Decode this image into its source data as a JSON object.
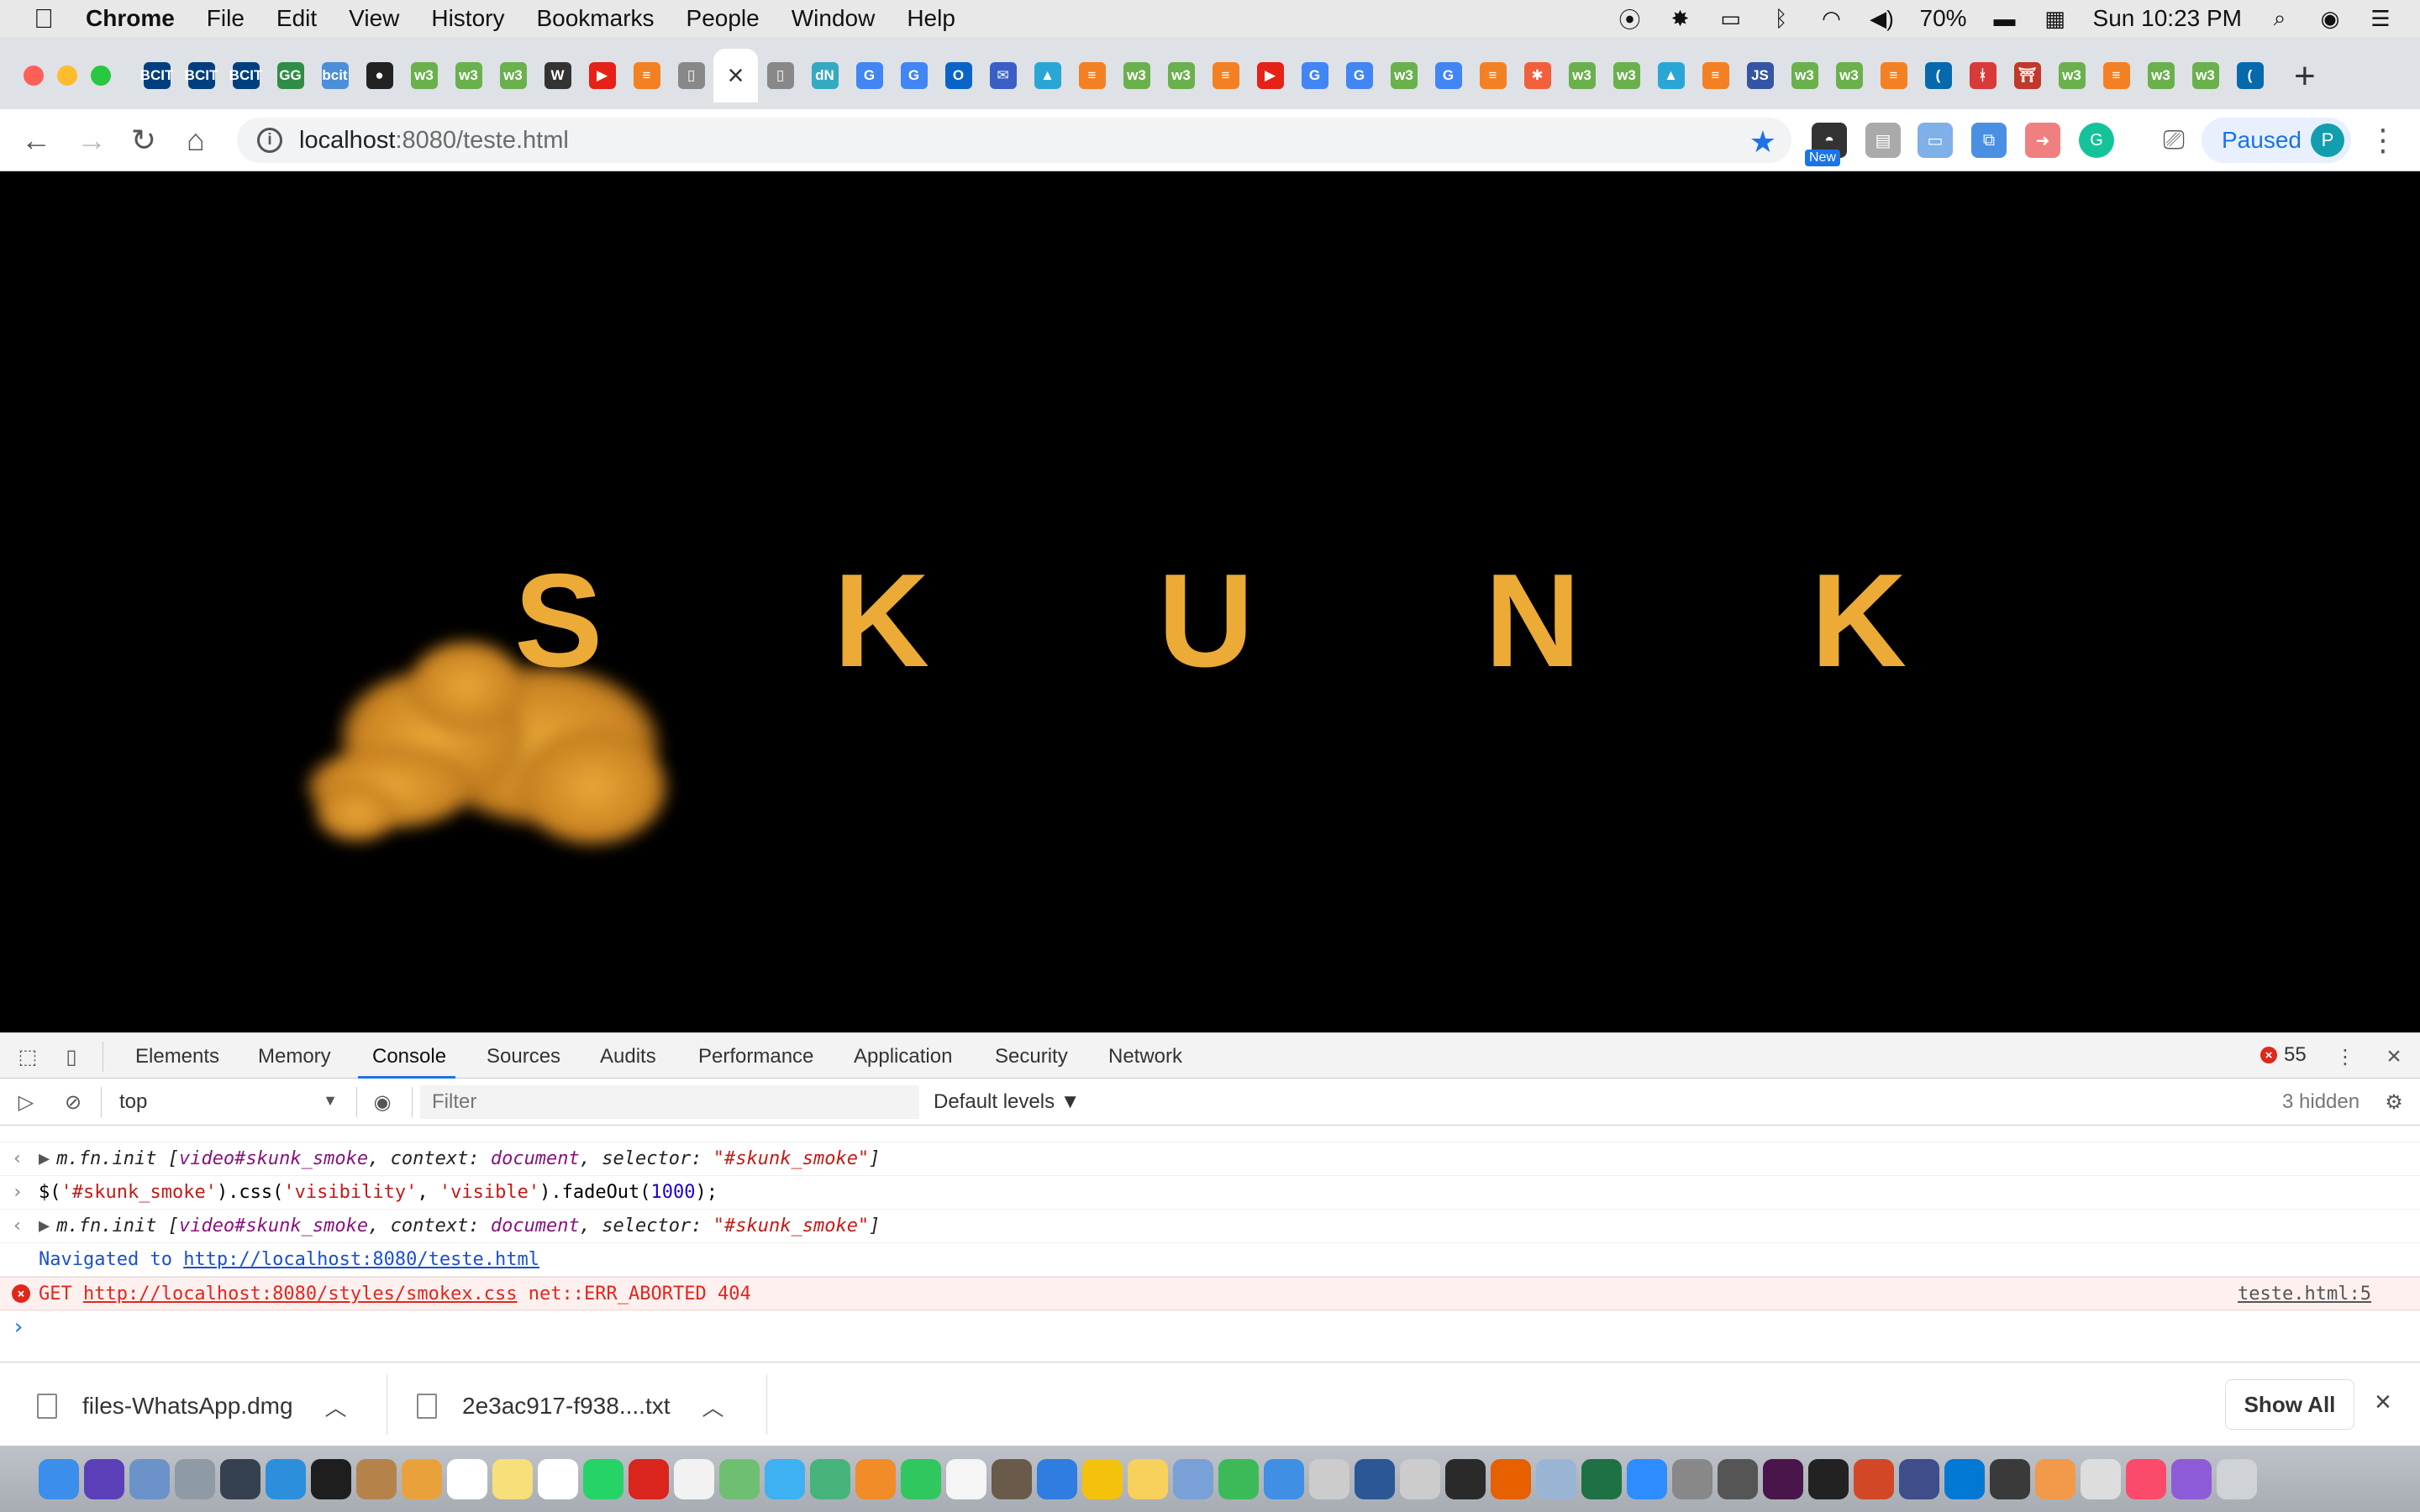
{
  "menubar": {
    "app_name": "Chrome",
    "items": [
      "File",
      "Edit",
      "View",
      "History",
      "Bookmarks",
      "People",
      "Window",
      "Help"
    ],
    "battery": "70%",
    "clock": "Sun 10:23 PM"
  },
  "tabs": [
    {
      "icon": "bcit-icon",
      "glyph": "BCIT",
      "color": "#003f7d"
    },
    {
      "icon": "bcit-icon",
      "glyph": "BCIT",
      "color": "#003f7d"
    },
    {
      "icon": "bcit-icon",
      "glyph": "BCIT",
      "color": "#003f7d"
    },
    {
      "icon": "geeksforgeeks-icon",
      "glyph": "GG",
      "color": "#2f8d46"
    },
    {
      "icon": "bcit-icon",
      "glyph": "bcit",
      "color": "#4a8fd8"
    },
    {
      "icon": "github-icon",
      "glyph": "●",
      "color": "#222222"
    },
    {
      "icon": "w3schools-icon",
      "glyph": "w3",
      "color": "#6ab04c"
    },
    {
      "icon": "w3schools-icon",
      "glyph": "w3",
      "color": "#6ab04c"
    },
    {
      "icon": "w3schools-icon",
      "glyph": "w3",
      "color": "#6ab04c"
    },
    {
      "icon": "wikipedia-icon",
      "glyph": "W",
      "color": "#333333"
    },
    {
      "icon": "youtube-icon",
      "glyph": "▶",
      "color": "#e62117"
    },
    {
      "icon": "stackoverflow-icon",
      "glyph": "≡",
      "color": "#f48024"
    },
    {
      "icon": "document-icon",
      "glyph": "▯",
      "color": "#888888"
    },
    {
      "icon": "close-icon",
      "glyph": "×",
      "color": "#ffffff",
      "active": true
    },
    {
      "icon": "document-icon",
      "glyph": "▯",
      "color": "#888888"
    },
    {
      "icon": "dn-icon",
      "glyph": "dN",
      "color": "#36a9c2"
    },
    {
      "icon": "google-icon",
      "glyph": "G",
      "color": "#4285f4"
    },
    {
      "icon": "google-icon",
      "glyph": "G",
      "color": "#4285f4"
    },
    {
      "icon": "outlook-icon",
      "glyph": "O",
      "color": "#0a64c8"
    },
    {
      "icon": "mail-icon",
      "glyph": "✉",
      "color": "#3a5ec4"
    },
    {
      "icon": "graduation-cap-icon",
      "glyph": "▲",
      "color": "#2aa6d6"
    },
    {
      "icon": "stackoverflow-icon",
      "glyph": "≡",
      "color": "#f48024"
    },
    {
      "icon": "w3schools-icon",
      "glyph": "w3",
      "color": "#6ab04c"
    },
    {
      "icon": "w3schools-icon",
      "glyph": "w3",
      "color": "#6ab04c"
    },
    {
      "icon": "stackoverflow-icon",
      "glyph": "≡",
      "color": "#f48024"
    },
    {
      "icon": "video-icon",
      "glyph": "▶",
      "color": "#e62117"
    },
    {
      "icon": "google-icon",
      "glyph": "G",
      "color": "#4285f4"
    },
    {
      "icon": "google-icon",
      "glyph": "G",
      "color": "#4285f4"
    },
    {
      "icon": "w3schools-icon",
      "glyph": "w3",
      "color": "#6ab04c"
    },
    {
      "icon": "google-icon",
      "glyph": "G",
      "color": "#4285f4"
    },
    {
      "icon": "stackoverflow-icon",
      "glyph": "≡",
      "color": "#f48024"
    },
    {
      "icon": "asterisk-icon",
      "glyph": "✱",
      "color": "#f25f3a"
    },
    {
      "icon": "w3schools-icon",
      "glyph": "w3",
      "color": "#6ab04c"
    },
    {
      "icon": "w3schools-icon",
      "glyph": "w3",
      "color": "#6ab04c"
    },
    {
      "icon": "graduation-cap-icon",
      "glyph": "▲",
      "color": "#2aa6d6"
    },
    {
      "icon": "stackoverflow-icon",
      "glyph": "≡",
      "color": "#f48024"
    },
    {
      "icon": "tutorial-icon",
      "glyph": "JS",
      "color": "#3455a4"
    },
    {
      "icon": "w3schools-icon",
      "glyph": "w3",
      "color": "#6ab04c"
    },
    {
      "icon": "w3schools-icon",
      "glyph": "w3",
      "color": "#6ab04c"
    },
    {
      "icon": "stackoverflow-icon",
      "glyph": "≡",
      "color": "#f48024"
    },
    {
      "icon": "jquery-icon",
      "glyph": "(",
      "color": "#0769ad"
    },
    {
      "icon": "figure-icon",
      "glyph": "ᚼ",
      "color": "#d83a3a"
    },
    {
      "icon": "gate-icon",
      "glyph": "⛩",
      "color": "#c0392b"
    },
    {
      "icon": "w3schools-icon",
      "glyph": "w3",
      "color": "#6ab04c"
    },
    {
      "icon": "stackoverflow-icon",
      "glyph": "≡",
      "color": "#f48024"
    },
    {
      "icon": "w3schools-icon",
      "glyph": "w3",
      "color": "#6ab04c"
    },
    {
      "icon": "w3schools-icon",
      "glyph": "w3",
      "color": "#6ab04c"
    },
    {
      "icon": "jquery-icon",
      "glyph": "(",
      "color": "#0769ad"
    }
  ],
  "omnibox": {
    "host": "localhost",
    "rest": ":8080/teste.html"
  },
  "extensions": {
    "new_badge": "New"
  },
  "profile": {
    "status": "Paused",
    "initial": "P"
  },
  "page": {
    "letters": [
      "S",
      "K",
      "U",
      "N",
      "K"
    ],
    "letter_color": "#ecaa36",
    "background": "#000000"
  },
  "devtools": {
    "tabs": [
      "Elements",
      "Memory",
      "Console",
      "Sources",
      "Audits",
      "Performance",
      "Application",
      "Security",
      "Network"
    ],
    "active_tab": "Console",
    "error_count": "55",
    "context": "top",
    "filter_placeholder": "Filter",
    "levels": "Default levels ▼",
    "hidden": "3 hidden",
    "console": {
      "line1": {
        "obj": "m.fn.init [",
        "tag": "video#skunk_smoke",
        "mid": ", context: ",
        "ctx": "document",
        "mid2": ", selector: ",
        "sel": "\"#skunk_smoke\"",
        "end": "]"
      },
      "cmd": {
        "a": "$(",
        "s1": "'#skunk_smoke'",
        "b": ").css(",
        "s2": "'visibility'",
        "c": ", ",
        "s3": "'visible'",
        "d": ").fadeOut(",
        "n": "1000",
        "e": ");"
      },
      "nav_label": "Navigated to ",
      "nav_url": "http://localhost:8080/teste.html",
      "err_method": "GET ",
      "err_url": "http://localhost:8080/styles/smokex.css",
      "err_msg": " net::ERR_ABORTED 404",
      "err_source": "teste.html:5"
    }
  },
  "downloads": {
    "items": [
      "files-WhatsApp.dmg",
      "2e3ac917-f938....txt"
    ],
    "show_all": "Show All"
  },
  "dock": [
    {
      "icon": "finder-icon",
      "color": "#3b8eea"
    },
    {
      "icon": "siri-icon",
      "color": "#5a3fb8"
    },
    {
      "icon": "preview-icon",
      "color": "#6b93c9"
    },
    {
      "icon": "launchpad-icon",
      "color": "#8e9aa6"
    },
    {
      "icon": "mission-control-icon",
      "color": "#35414f"
    },
    {
      "icon": "safari-icon",
      "color": "#2b8fdb"
    },
    {
      "icon": "terminal-icon",
      "color": "#1e1e1e"
    },
    {
      "icon": "notebook-icon",
      "color": "#b5834a"
    },
    {
      "icon": "photos-icon",
      "color": "#e9a23b"
    },
    {
      "icon": "calendar-icon",
      "color": "#ffffff"
    },
    {
      "icon": "notes-icon",
      "color": "#f7e07a"
    },
    {
      "icon": "apps-icon",
      "color": "#ffffff"
    },
    {
      "icon": "whatsapp-icon",
      "color": "#25d366"
    },
    {
      "icon": "acrobat-icon",
      "color": "#d9251c"
    },
    {
      "icon": "textedit-icon",
      "color": "#f2f2f2"
    },
    {
      "icon": "maps-icon",
      "color": "#6fbf73"
    },
    {
      "icon": "messages-icon",
      "color": "#3db1f2"
    },
    {
      "icon": "atom-icon",
      "color": "#47b37c"
    },
    {
      "icon": "books-icon",
      "color": "#f28c28"
    },
    {
      "icon": "facetime-icon",
      "color": "#30c75e"
    },
    {
      "icon": "panda-icon",
      "color": "#f5f5f5"
    },
    {
      "icon": "camera-icon",
      "color": "#6a5a4a"
    },
    {
      "icon": "keynote-icon",
      "color": "#2f7de1"
    },
    {
      "icon": "chrome-icon",
      "color": "#f4c20d"
    },
    {
      "icon": "emoji-icon",
      "color": "#f8d05c"
    },
    {
      "icon": "pencil-icon",
      "color": "#7aa0d8"
    },
    {
      "icon": "numbers-icon",
      "color": "#3dba58"
    },
    {
      "icon": "xcode-icon",
      "color": "#3f8fe5"
    },
    {
      "icon": "help-icon",
      "color": "#cccccc"
    },
    {
      "icon": "word-icon",
      "color": "#2b5797"
    },
    {
      "icon": "help-icon",
      "color": "#cccccc"
    },
    {
      "icon": "activity-monitor-icon",
      "color": "#2a2a2a"
    },
    {
      "icon": "firefox-icon",
      "color": "#e66000"
    },
    {
      "icon": "scanner-icon",
      "color": "#9ab4d4"
    },
    {
      "icon": "excel-icon",
      "color": "#1e7145"
    },
    {
      "icon": "zoom-icon",
      "color": "#2d8cff"
    },
    {
      "icon": "tool-icon",
      "color": "#888888"
    },
    {
      "icon": "bird-icon",
      "color": "#555555"
    },
    {
      "icon": "slack-icon",
      "color": "#4a154b"
    },
    {
      "icon": "x-icon",
      "color": "#222222"
    },
    {
      "icon": "powerpoint-icon",
      "color": "#d24726"
    },
    {
      "icon": "globe-icon",
      "color": "#3d4e8a"
    },
    {
      "icon": "vscode-icon",
      "color": "#0078d4"
    },
    {
      "icon": "compass-icon",
      "color": "#3a3a3a"
    },
    {
      "icon": "lock-icon",
      "color": "#f2994a"
    },
    {
      "icon": "document-icon",
      "color": "#dddddd"
    },
    {
      "icon": "music-icon",
      "color": "#fb4a6a"
    },
    {
      "icon": "star-icon",
      "color": "#8e5bd8"
    },
    {
      "icon": "trash-icon",
      "color": "#cfd3d8"
    }
  ]
}
